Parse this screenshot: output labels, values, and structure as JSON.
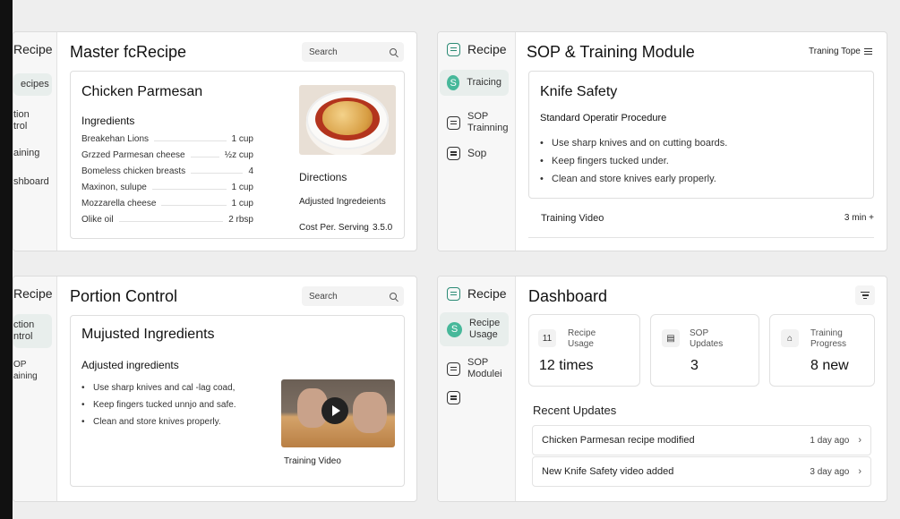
{
  "panel_master": {
    "sidebar": {
      "brand": "Recipe",
      "items": [
        {
          "label": "ecipes"
        },
        {
          "label": "tion\ntrol"
        },
        {
          "label": "aining"
        },
        {
          "label": "shboard"
        }
      ]
    },
    "title": "Master fcRecipe",
    "search_label": "Search",
    "recipe": {
      "name": "Chicken Parmesan",
      "ingredients_heading": "Ingredients",
      "ingredients": [
        {
          "name": "Breakehan Lions",
          "amount": "1 cup"
        },
        {
          "name": "Grzzed Parmesan cheese",
          "amount": "½z cup"
        },
        {
          "name": "Bomeless chicken breasts",
          "amount": "4"
        },
        {
          "name": "Maxinon, sulupe",
          "amount": "1 cup"
        },
        {
          "name": "Mozzarella cheese",
          "amount": "1 cup"
        },
        {
          "name": "Olike oil",
          "amount": "2 rbsp"
        }
      ],
      "directions": "Directions",
      "adjusted": "Adjusted Ingredeients",
      "cost_label": "Cost Per. Serving",
      "cost_value": "3.5.0"
    }
  },
  "panel_sop": {
    "sidebar": {
      "brand": "Recipe",
      "items": [
        {
          "label": "Traicing",
          "icon": "S"
        },
        {
          "label": "SOP\nTrainning"
        },
        {
          "label": "Sop"
        }
      ]
    },
    "title": "SOP & Training Module",
    "topic": "Traning Tope",
    "card": {
      "title": "Knife Safety",
      "procedure": "Standard Operatir Procedure",
      "bullets": [
        "Use sharp knives and on cutting boards.",
        "Keep fingers tucked under.",
        "Clean and store knives early properly."
      ],
      "video_label": "Training Video",
      "video_duration": "3 min +"
    }
  },
  "panel_portion": {
    "sidebar": {
      "brand": "Recipe",
      "items": [
        {
          "label": "ction\nntrol"
        },
        {
          "label": "OP\naining"
        }
      ]
    },
    "title": "Portion Control",
    "search_label": "Search",
    "card": {
      "title": "Mujusted Ingredients",
      "subheading": "Adjusted ingredients",
      "bullets": [
        "Use sharp knives and cal -lag coad,",
        "Keep fingers tucked unnjo and safe.",
        "Clean and store knives properly."
      ],
      "video_caption": "Training Video"
    }
  },
  "panel_dashboard": {
    "sidebar": {
      "brand": "Recipe",
      "items": [
        {
          "label": "Recipe\nUsage",
          "icon": "S"
        },
        {
          "label": "SOP\nModulei"
        },
        {
          "label": ""
        }
      ]
    },
    "title": "Dashboard",
    "stats": [
      {
        "icon": "11",
        "label": "Recipe\nUsage",
        "value": "12 times"
      },
      {
        "icon": "▤",
        "label": "SOP\nUpdates",
        "value": "3"
      },
      {
        "icon": "⌂",
        "label": "Training\nProgress",
        "value": "8 new"
      }
    ],
    "recent_heading": "Recent Updates",
    "updates": [
      {
        "text": "Chicken Parmesan recipe modified",
        "ago": "1 day ago"
      },
      {
        "text": "New Knife Safety video added",
        "ago": "3 day ago"
      }
    ]
  },
  "colors": {
    "accent": "#2a8a74",
    "accent_light": "#47b89a",
    "background": "#eeeeee"
  }
}
